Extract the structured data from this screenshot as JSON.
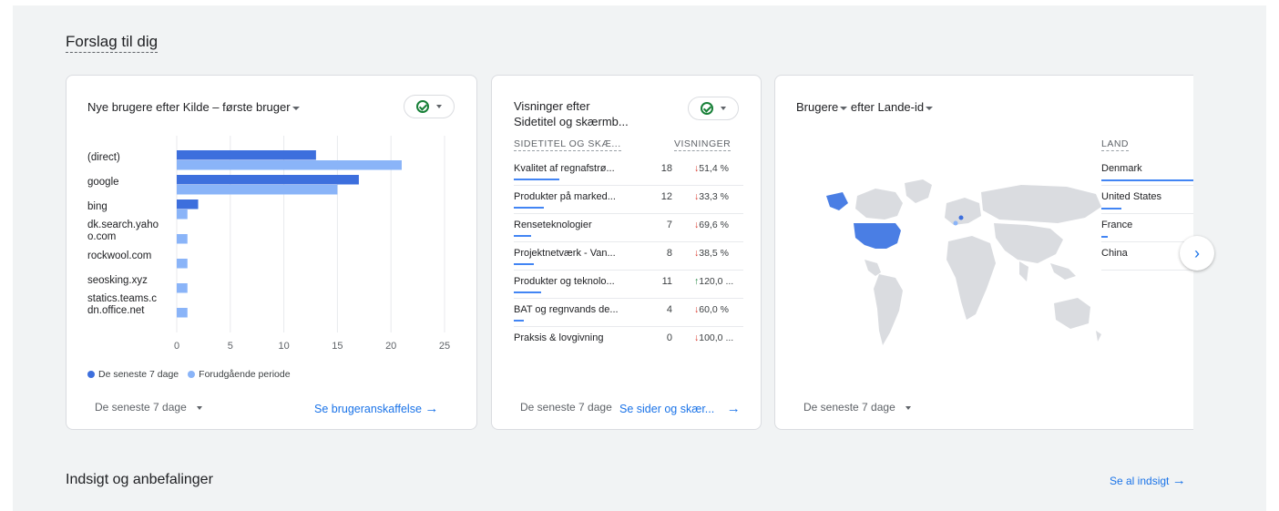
{
  "section_title": "Forslag til dig",
  "card1": {
    "title": "Nye brugere efter Kilde – første bruger",
    "footer_range": "De seneste 7 dage",
    "footer_link": "Se brugeranskaffelse",
    "legend": [
      "De seneste 7 dage",
      "Forudgående periode"
    ]
  },
  "chart_data": {
    "type": "bar",
    "orientation": "horizontal",
    "categories": [
      "(direct)",
      "google",
      "bing",
      "dk.search.yahoo.com",
      "rockwool.com",
      "seosking.xyz",
      "statics.teams.cdn.office.net"
    ],
    "category_display": [
      "(direct)",
      "google",
      "bing",
      "dk.search.yaho\no.com",
      "rockwool.com",
      "seosking.xyz",
      "statics.teams.c\ndn.office.net"
    ],
    "series": [
      {
        "name": "De seneste 7 dage",
        "color": "#3d6fdd",
        "values": [
          13,
          17,
          2,
          0,
          0,
          0,
          0
        ]
      },
      {
        "name": "Forudgående periode",
        "color": "#8ab4f8",
        "values": [
          21,
          15,
          1,
          1,
          1,
          1,
          1
        ]
      }
    ],
    "xlim": [
      0,
      25
    ],
    "xticks": [
      "0",
      "5",
      "10",
      "15",
      "20",
      "25"
    ],
    "grid": true,
    "legend_position": "bottom-left"
  },
  "card2": {
    "title_line1": "Visninger efter",
    "title_line2": "Sidetitel og skærmb...",
    "col1": "SIDETITEL OG SKÆ...",
    "col2": "VISNINGER",
    "rows": [
      {
        "name": "Kvalitet af regnafstrø...",
        "value": "18",
        "arrow": "↓",
        "dir": "down",
        "change": "51,4 %",
        "bar": 0.45
      },
      {
        "name": "Produkter på marked...",
        "value": "12",
        "arrow": "↓",
        "dir": "down",
        "change": "33,3 %",
        "bar": 0.3
      },
      {
        "name": "Renseteknologier",
        "value": "7",
        "arrow": "↓",
        "dir": "down",
        "change": "69,6 %",
        "bar": 0.17
      },
      {
        "name": "Projektnetværk - Van...",
        "value": "8",
        "arrow": "↓",
        "dir": "down",
        "change": "38,5 %",
        "bar": 0.2
      },
      {
        "name": "Produkter og teknolo...",
        "value": "11",
        "arrow": "↑",
        "dir": "up",
        "change": "120,0 ...",
        "bar": 0.27
      },
      {
        "name": "BAT og regnvands de...",
        "value": "4",
        "arrow": "↓",
        "dir": "down",
        "change": "60,0 %",
        "bar": 0.1
      },
      {
        "name": "Praksis & lovgivning",
        "value": "0",
        "arrow": "↓",
        "dir": "down",
        "change": "100,0 ...",
        "bar": 0.0
      }
    ],
    "footer_range": "De seneste 7 dage",
    "footer_link": "Se sider og skær..."
  },
  "card3": {
    "title_a": "Brugere",
    "title_b": "efter Lande-id",
    "col": "LAND",
    "countries": [
      {
        "name": "Denmark",
        "bar": 1.0
      },
      {
        "name": "United States",
        "bar": 0.18
      },
      {
        "name": "France",
        "bar": 0.06
      },
      {
        "name": "China",
        "bar": 0.0
      }
    ],
    "footer_range": "De seneste 7 dage"
  },
  "insights": {
    "title": "Indsigt og anbefalinger",
    "link": "Se al indsigt"
  },
  "colors": {
    "accent": "#1a73e8",
    "bar_primary": "#3d6fdd",
    "bar_secondary": "#8ab4f8",
    "down": "#d93025",
    "up": "#188038"
  }
}
